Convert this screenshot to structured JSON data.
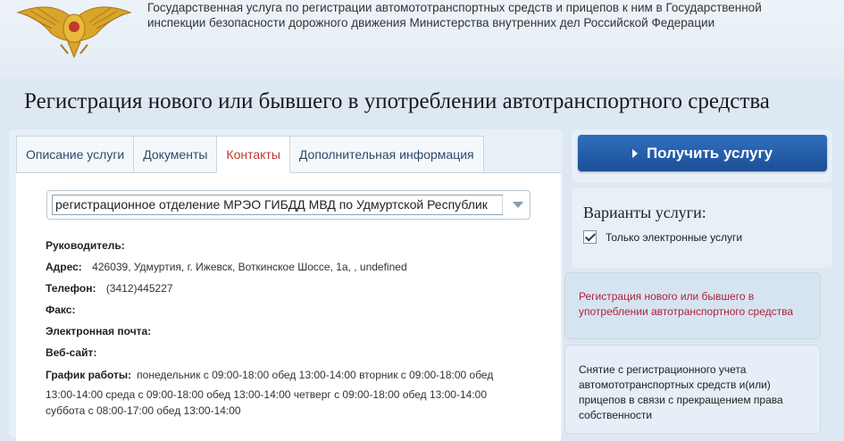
{
  "header": {
    "description": "Государственная услуга по регистрации автомототранспортных средств и прицепов к ним в Государственной инспекции безопасности дорожного движения Министерства внутренних дел Российской Федерации"
  },
  "page_title": "Регистрация нового или бывшего в употреблении автотранспортного средства",
  "tabs": [
    {
      "label": "Описание услуги",
      "active": false
    },
    {
      "label": "Документы",
      "active": false
    },
    {
      "label": "Контакты",
      "active": true
    },
    {
      "label": "Дополнительная информация",
      "active": false
    }
  ],
  "department_select": {
    "value": "регистрационное отделение МРЭО ГИБДД МВД по Удмуртской Республик"
  },
  "contacts": {
    "head_label": "Руководитель:",
    "address_label": "Адрес:",
    "address_value": "426039, Удмуртия, г. Ижевск, Воткинское Шоссе, 1а, , undefined",
    "phone_label": "Телефон:",
    "phone_value": "(3412)445227",
    "fax_label": "Факс:",
    "email_label": "Электронная почта:",
    "website_label": "Веб-сайт:",
    "schedule_label": "График работы:",
    "schedule_line1": "понедельник с 09:00-18:00 обед 13:00-14:00 вторник с 09:00-18:00 обед",
    "schedule_line2": "13:00-14:00 среда с 09:00-18:00 обед 13:00-14:00 четверг с 09:00-18:00 обед 13:00-14:00",
    "schedule_line3": "суббота с 08:00-17:00 обед 13:00-14:00"
  },
  "sidebar": {
    "cta_label": "Получить услугу",
    "variants_title": "Варианты услуги:",
    "only_electronic_label": "Только электронные услуги",
    "only_electronic_checked": true,
    "variants": [
      {
        "label": "Регистрация нового или бывшего в употреблении автотранспортного средства",
        "active": true
      },
      {
        "label": "Снятие с регистрационного учета автомототранспортных средств и(или) прицепов в связи с прекращением права собственности",
        "active": false
      }
    ]
  },
  "colors": {
    "accent_blue": "#1c4f96",
    "active_red": "#b0213a",
    "background": "#dde8f2"
  },
  "icons": {
    "emblem": "mvd-double-headed-eagle-emblem",
    "cta_arrow": "arrow-right-icon",
    "select_arrow": "chevron-down-icon",
    "checkbox": "checkmark-icon"
  }
}
